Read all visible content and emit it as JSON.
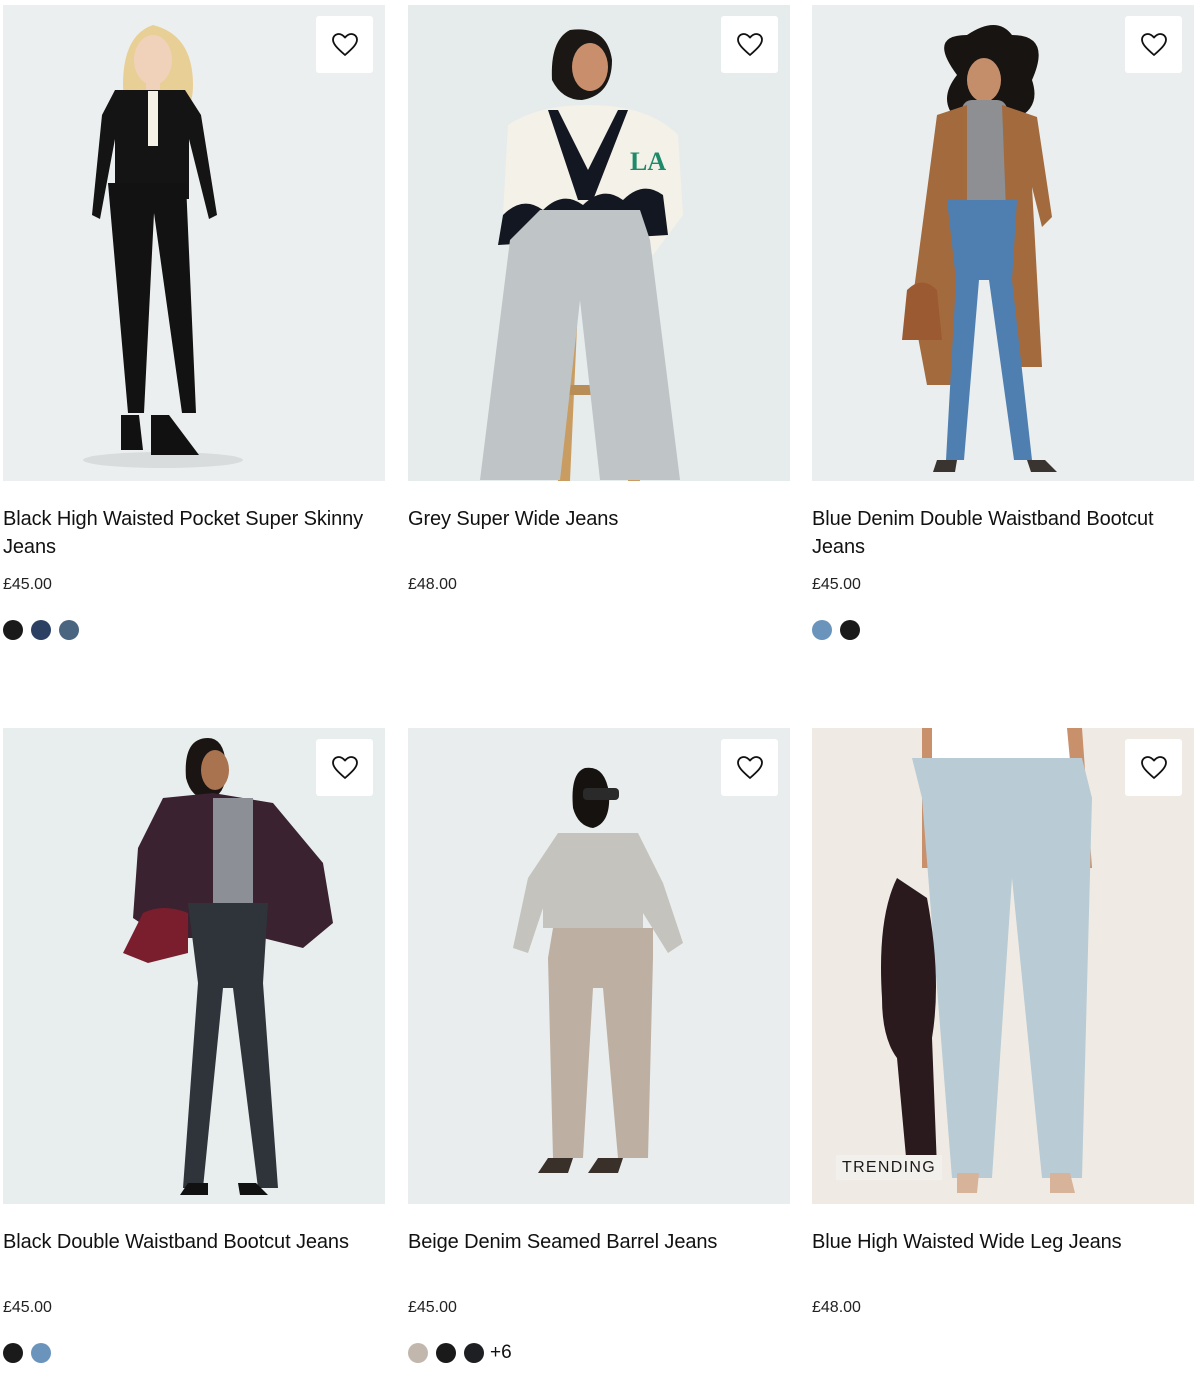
{
  "products": [
    {
      "title": "Black High Waisted Pocket Super Skinny Jeans",
      "price": "£45.00",
      "bg": "#eceff0",
      "swatches": [
        "#1a1a1a",
        "#2c4064",
        "#4a6580"
      ],
      "more": "",
      "badge": ""
    },
    {
      "title": "Grey Super Wide Jeans",
      "price": "£48.00",
      "bg": "#e6ecec",
      "swatches": [],
      "more": "",
      "badge": ""
    },
    {
      "title": "Blue Denim Double Waistband Bootcut Jeans",
      "price": "£45.00",
      "bg": "#eaeeee",
      "swatches": [
        "#6a94bb",
        "#1a1a1a"
      ],
      "more": "",
      "badge": ""
    },
    {
      "title": "Black Double Waistband Bootcut Jeans",
      "price": "£45.00",
      "bg": "#e8eeee",
      "swatches": [
        "#1a1a1a",
        "#6a94bb"
      ],
      "more": "",
      "badge": ""
    },
    {
      "title": "Beige Denim Seamed Barrel Jeans",
      "price": "£45.00",
      "bg": "#e9eded",
      "swatches": [
        "#c2b7ac",
        "#1a1a1a",
        "#1e1f22"
      ],
      "more": "+6",
      "badge": ""
    },
    {
      "title": "Blue High Waisted Wide Leg Jeans",
      "price": "£48.00",
      "bg": "#efebe4",
      "swatches": [],
      "more": "",
      "badge": "TRENDING"
    }
  ],
  "icons": {
    "wishlist": "heart-outline-icon"
  }
}
